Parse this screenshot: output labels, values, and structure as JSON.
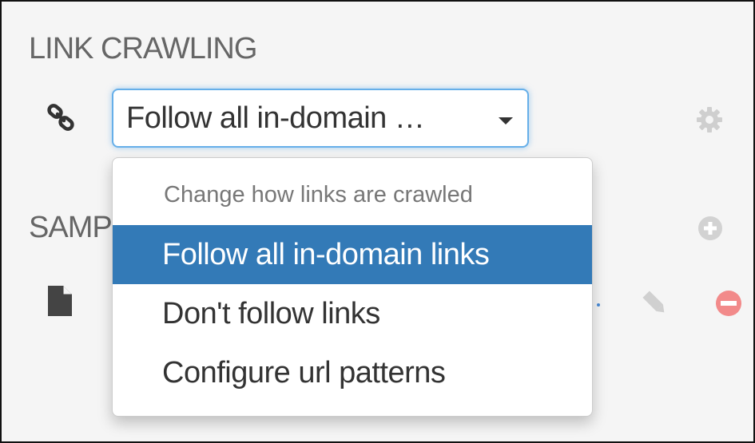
{
  "link_crawling": {
    "title": "LINK CRAWLING",
    "select": {
      "value": "Follow all in-domain …",
      "dropdown": {
        "header": "Change how links are crawled",
        "options": [
          {
            "label": "Follow all in-domain links",
            "selected": true
          },
          {
            "label": "Don't follow links",
            "selected": false
          },
          {
            "label": "Configure url patterns",
            "selected": false
          }
        ]
      }
    }
  },
  "samples": {
    "title": "SAMPLES"
  },
  "icons": {
    "link": "link-icon",
    "gear": "gear-icon",
    "plus": "plus-circle-icon",
    "document": "document-icon",
    "pencil": "pencil-icon",
    "remove": "minus-circle-icon"
  },
  "colors": {
    "selected_bg": "#337ab7",
    "focus_border": "#66afe9",
    "remove_red": "#f28a8a"
  }
}
